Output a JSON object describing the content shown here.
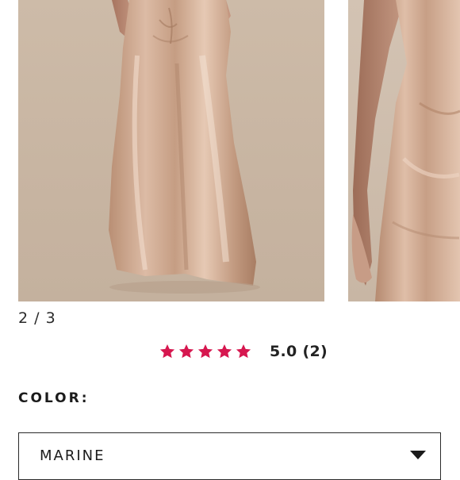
{
  "gallery": {
    "current_slide": 2,
    "total_slides": 3,
    "pager_text": "2 / 3"
  },
  "rating": {
    "stars": 5,
    "score_text": "5.0 (2)",
    "star_color": "#d6174f"
  },
  "color": {
    "label": "COLOR:",
    "selected": "MARINE"
  },
  "colors": {
    "dress_satin": "#c9a58e",
    "background": "#cbb9a6"
  }
}
